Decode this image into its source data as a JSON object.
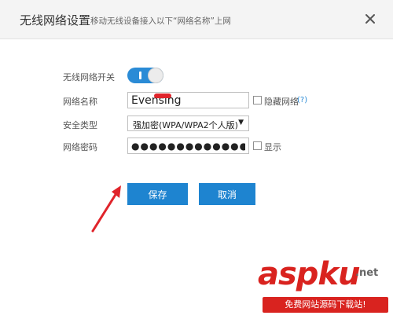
{
  "dialog": {
    "title": "无线网络设置",
    "subtitle": "移动无线设备接入以下“网络名称”上网"
  },
  "form": {
    "wifi_switch_label": "无线网络开关",
    "wifi_switch_on": true,
    "ssid_label": "网络名称",
    "ssid_value": "Evensing",
    "hide_ssid_label": "隐藏网络",
    "help_label": "(?)",
    "security_label": "安全类型",
    "security_value": "强加密(WPA/WPA2个人版)",
    "password_label": "网络密码",
    "password_value": "●●●●●●●●●●●●●",
    "show_password_label": "显示"
  },
  "buttons": {
    "save": "保存",
    "cancel": "取消"
  },
  "watermark": {
    "logo": "aspku",
    "net": ".net",
    "slogan": "免费网站源码下载站!"
  },
  "colors": {
    "accent": "#1e84d0",
    "toggle": "#2a8bd6",
    "annotation": "#e0242b"
  }
}
